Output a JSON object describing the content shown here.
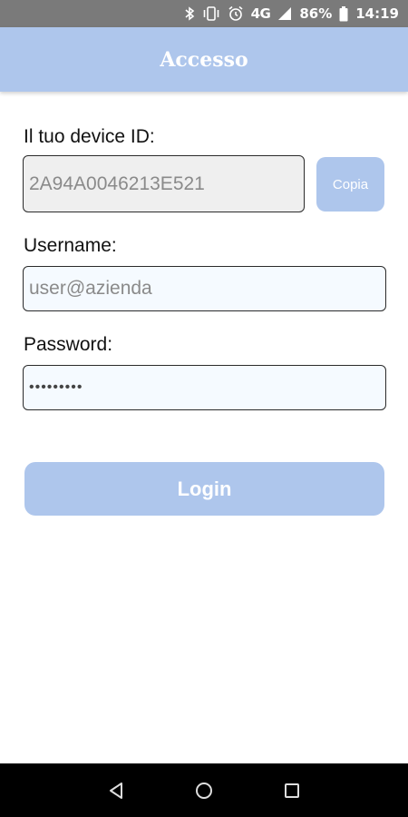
{
  "status_bar": {
    "network": "4G",
    "battery": "86%",
    "time": "14:19"
  },
  "app_bar": {
    "title": "Accesso"
  },
  "form": {
    "device_id_label": "Il tuo device ID:",
    "device_id_value": "2A94A0046213E521",
    "copy_button": "Copia",
    "username_label": "Username:",
    "username_placeholder": "user@azienda",
    "password_label": "Password:",
    "password_value": "•••••••••",
    "login_button": "Login"
  },
  "colors": {
    "accent": "#aec6ec",
    "status_bar": "#7a7a7a",
    "nav_bar": "#000000"
  },
  "icons": [
    "bluetooth-icon",
    "vibrate-icon",
    "alarm-icon",
    "signal-icon",
    "battery-icon",
    "back-icon",
    "home-icon",
    "recents-icon"
  ]
}
